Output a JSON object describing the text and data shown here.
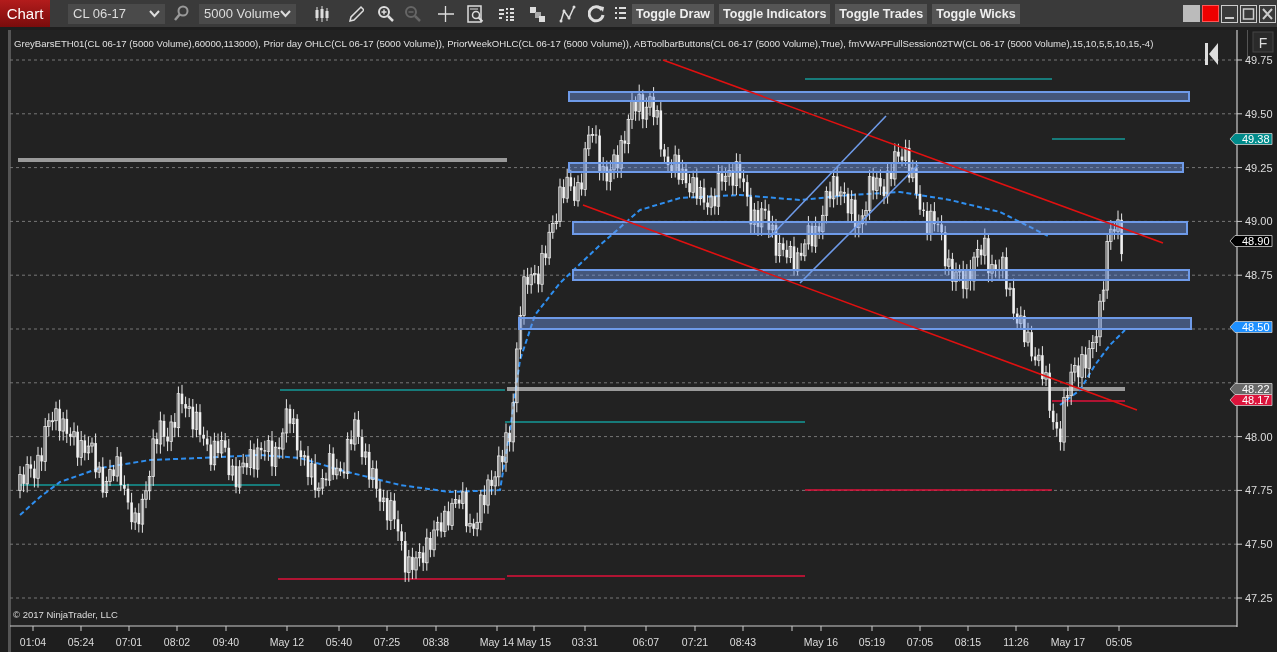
{
  "toolbar": {
    "chart_button": "Chart",
    "instrument": "CL 06-17",
    "interval": "5000 Volume",
    "toggles": [
      "Toggle Draw",
      "Toggle Indicators",
      "Toggle Trades",
      "Toggle Wicks"
    ]
  },
  "indicators_label": "GreyBarsETH01(CL 06-17 (5000 Volume),60000,113000), Prior day OHLC(CL 06-17 (5000 Volume)), PriorWeekOHLC(CL 06-17 (5000 Volume)), ABToolbarButtons(CL 06-17 (5000 Volume),True), fmVWAPFullSession02TW(CL 06-17 (5000 Volume),15,10,5,5,10,15,-4)",
  "side_button": "F",
  "price_axis": {
    "ticks": [
      "49.75",
      "49.50",
      "49.25",
      "49.00",
      "48.75",
      "48.00",
      "47.75",
      "47.50",
      "47.25"
    ]
  },
  "price_markers": [
    {
      "value": "49.38",
      "color": "#008b8b"
    },
    {
      "value": "48.90",
      "color": "#000000"
    },
    {
      "value": "48.50",
      "color": "#1e90ff"
    },
    {
      "value": "48.22",
      "color": "#696969"
    },
    {
      "value": "48.17",
      "color": "#dc143c"
    }
  ],
  "copyright": "© 2017 NinjaTrader, LLC",
  "time_axis": {
    "labels": [
      "01:04",
      "05:24",
      "07:01",
      "08:02",
      "09:40",
      "May 12",
      "05:40",
      "07:25",
      "08:38",
      "May 14",
      "May 15",
      "03:31",
      "06:07",
      "07:21",
      "08:43",
      "May 16",
      "05:19",
      "07:05",
      "08:15",
      "11:26",
      "May 17",
      "05:05"
    ]
  }
}
